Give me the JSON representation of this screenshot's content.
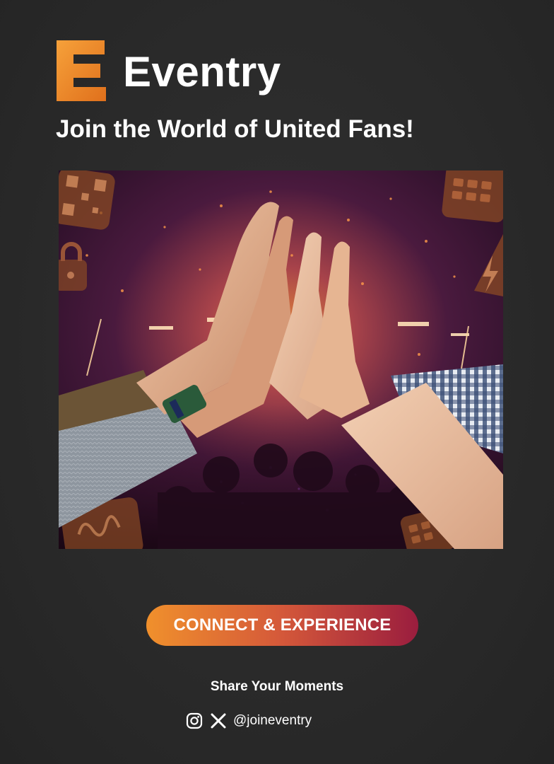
{
  "brand": {
    "logo_icon": "eventry-e-logo-icon",
    "name": "Eventry"
  },
  "tagline": "Join the World of United Fans!",
  "hero": {
    "alt": "Fans giving a group high five in front of a concert crowd with confetti",
    "icons": [
      "qr-code-icon",
      "lock-icon",
      "ticket-icon",
      "lightning-icon",
      "signature-icon",
      "badge-icon"
    ]
  },
  "cta": {
    "label": "CONNECT & EXPERIENCE"
  },
  "footer": {
    "share_label": "Share Your Moments",
    "social_icons": [
      "instagram-icon",
      "x-icon"
    ],
    "handle": "@joineventry"
  },
  "colors": {
    "background": "#2a2a2a",
    "brand_orange": "#f08a24",
    "cta_start": "#f0902c",
    "cta_end": "#9a1d3e",
    "text": "#ffffff"
  }
}
